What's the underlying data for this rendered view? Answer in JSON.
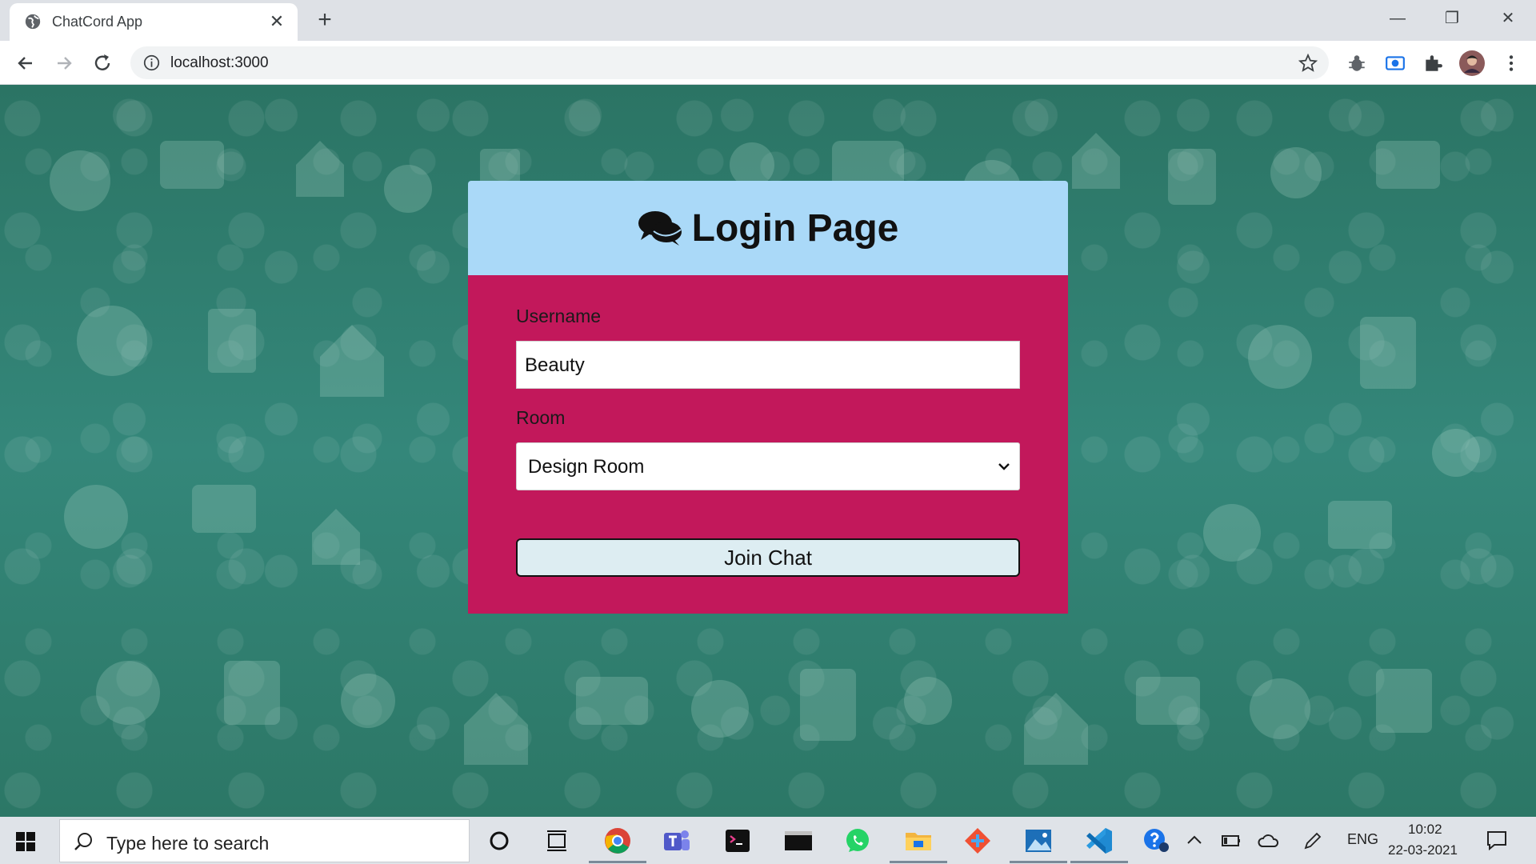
{
  "browser": {
    "tab_title": "ChatCord App",
    "url": "localhost:3000"
  },
  "card": {
    "title": "Login Page",
    "username_label": "Username",
    "username_value": "Beauty",
    "room_label": "Room",
    "room_selected": "Design Room",
    "join_button": "Join Chat",
    "header_color": "#aad9f8",
    "body_color": "#c2185b"
  },
  "taskbar": {
    "search_placeholder": "Type here to search",
    "language": "ENG",
    "time": "10:02",
    "date": "22-03-2021"
  }
}
